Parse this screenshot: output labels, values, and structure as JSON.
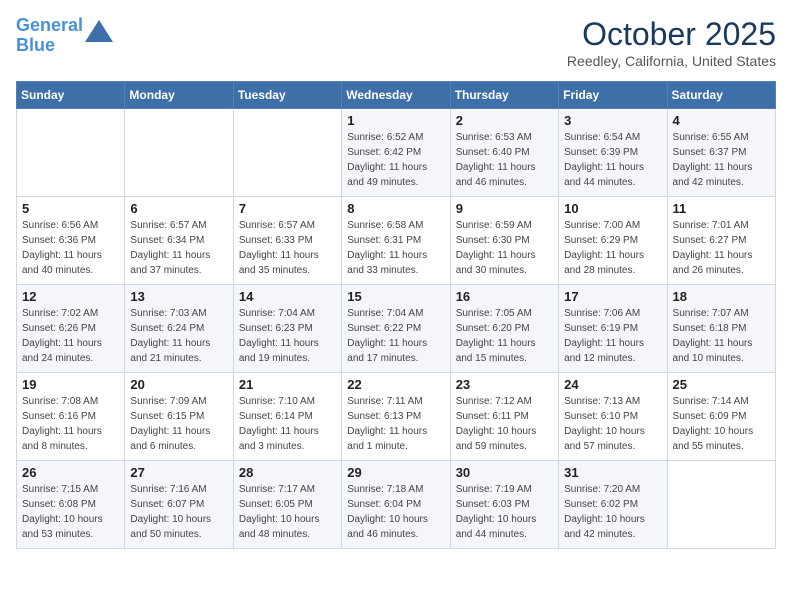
{
  "header": {
    "logo_line1": "General",
    "logo_line2": "Blue",
    "month_year": "October 2025",
    "location": "Reedley, California, United States"
  },
  "weekdays": [
    "Sunday",
    "Monday",
    "Tuesday",
    "Wednesday",
    "Thursday",
    "Friday",
    "Saturday"
  ],
  "weeks": [
    [
      {
        "day": "",
        "info": ""
      },
      {
        "day": "",
        "info": ""
      },
      {
        "day": "",
        "info": ""
      },
      {
        "day": "1",
        "info": "Sunrise: 6:52 AM\nSunset: 6:42 PM\nDaylight: 11 hours\nand 49 minutes."
      },
      {
        "day": "2",
        "info": "Sunrise: 6:53 AM\nSunset: 6:40 PM\nDaylight: 11 hours\nand 46 minutes."
      },
      {
        "day": "3",
        "info": "Sunrise: 6:54 AM\nSunset: 6:39 PM\nDaylight: 11 hours\nand 44 minutes."
      },
      {
        "day": "4",
        "info": "Sunrise: 6:55 AM\nSunset: 6:37 PM\nDaylight: 11 hours\nand 42 minutes."
      }
    ],
    [
      {
        "day": "5",
        "info": "Sunrise: 6:56 AM\nSunset: 6:36 PM\nDaylight: 11 hours\nand 40 minutes."
      },
      {
        "day": "6",
        "info": "Sunrise: 6:57 AM\nSunset: 6:34 PM\nDaylight: 11 hours\nand 37 minutes."
      },
      {
        "day": "7",
        "info": "Sunrise: 6:57 AM\nSunset: 6:33 PM\nDaylight: 11 hours\nand 35 minutes."
      },
      {
        "day": "8",
        "info": "Sunrise: 6:58 AM\nSunset: 6:31 PM\nDaylight: 11 hours\nand 33 minutes."
      },
      {
        "day": "9",
        "info": "Sunrise: 6:59 AM\nSunset: 6:30 PM\nDaylight: 11 hours\nand 30 minutes."
      },
      {
        "day": "10",
        "info": "Sunrise: 7:00 AM\nSunset: 6:29 PM\nDaylight: 11 hours\nand 28 minutes."
      },
      {
        "day": "11",
        "info": "Sunrise: 7:01 AM\nSunset: 6:27 PM\nDaylight: 11 hours\nand 26 minutes."
      }
    ],
    [
      {
        "day": "12",
        "info": "Sunrise: 7:02 AM\nSunset: 6:26 PM\nDaylight: 11 hours\nand 24 minutes."
      },
      {
        "day": "13",
        "info": "Sunrise: 7:03 AM\nSunset: 6:24 PM\nDaylight: 11 hours\nand 21 minutes."
      },
      {
        "day": "14",
        "info": "Sunrise: 7:04 AM\nSunset: 6:23 PM\nDaylight: 11 hours\nand 19 minutes."
      },
      {
        "day": "15",
        "info": "Sunrise: 7:04 AM\nSunset: 6:22 PM\nDaylight: 11 hours\nand 17 minutes."
      },
      {
        "day": "16",
        "info": "Sunrise: 7:05 AM\nSunset: 6:20 PM\nDaylight: 11 hours\nand 15 minutes."
      },
      {
        "day": "17",
        "info": "Sunrise: 7:06 AM\nSunset: 6:19 PM\nDaylight: 11 hours\nand 12 minutes."
      },
      {
        "day": "18",
        "info": "Sunrise: 7:07 AM\nSunset: 6:18 PM\nDaylight: 11 hours\nand 10 minutes."
      }
    ],
    [
      {
        "day": "19",
        "info": "Sunrise: 7:08 AM\nSunset: 6:16 PM\nDaylight: 11 hours\nand 8 minutes."
      },
      {
        "day": "20",
        "info": "Sunrise: 7:09 AM\nSunset: 6:15 PM\nDaylight: 11 hours\nand 6 minutes."
      },
      {
        "day": "21",
        "info": "Sunrise: 7:10 AM\nSunset: 6:14 PM\nDaylight: 11 hours\nand 3 minutes."
      },
      {
        "day": "22",
        "info": "Sunrise: 7:11 AM\nSunset: 6:13 PM\nDaylight: 11 hours\nand 1 minute."
      },
      {
        "day": "23",
        "info": "Sunrise: 7:12 AM\nSunset: 6:11 PM\nDaylight: 10 hours\nand 59 minutes."
      },
      {
        "day": "24",
        "info": "Sunrise: 7:13 AM\nSunset: 6:10 PM\nDaylight: 10 hours\nand 57 minutes."
      },
      {
        "day": "25",
        "info": "Sunrise: 7:14 AM\nSunset: 6:09 PM\nDaylight: 10 hours\nand 55 minutes."
      }
    ],
    [
      {
        "day": "26",
        "info": "Sunrise: 7:15 AM\nSunset: 6:08 PM\nDaylight: 10 hours\nand 53 minutes."
      },
      {
        "day": "27",
        "info": "Sunrise: 7:16 AM\nSunset: 6:07 PM\nDaylight: 10 hours\nand 50 minutes."
      },
      {
        "day": "28",
        "info": "Sunrise: 7:17 AM\nSunset: 6:05 PM\nDaylight: 10 hours\nand 48 minutes."
      },
      {
        "day": "29",
        "info": "Sunrise: 7:18 AM\nSunset: 6:04 PM\nDaylight: 10 hours\nand 46 minutes."
      },
      {
        "day": "30",
        "info": "Sunrise: 7:19 AM\nSunset: 6:03 PM\nDaylight: 10 hours\nand 44 minutes."
      },
      {
        "day": "31",
        "info": "Sunrise: 7:20 AM\nSunset: 6:02 PM\nDaylight: 10 hours\nand 42 minutes."
      },
      {
        "day": "",
        "info": ""
      }
    ]
  ]
}
